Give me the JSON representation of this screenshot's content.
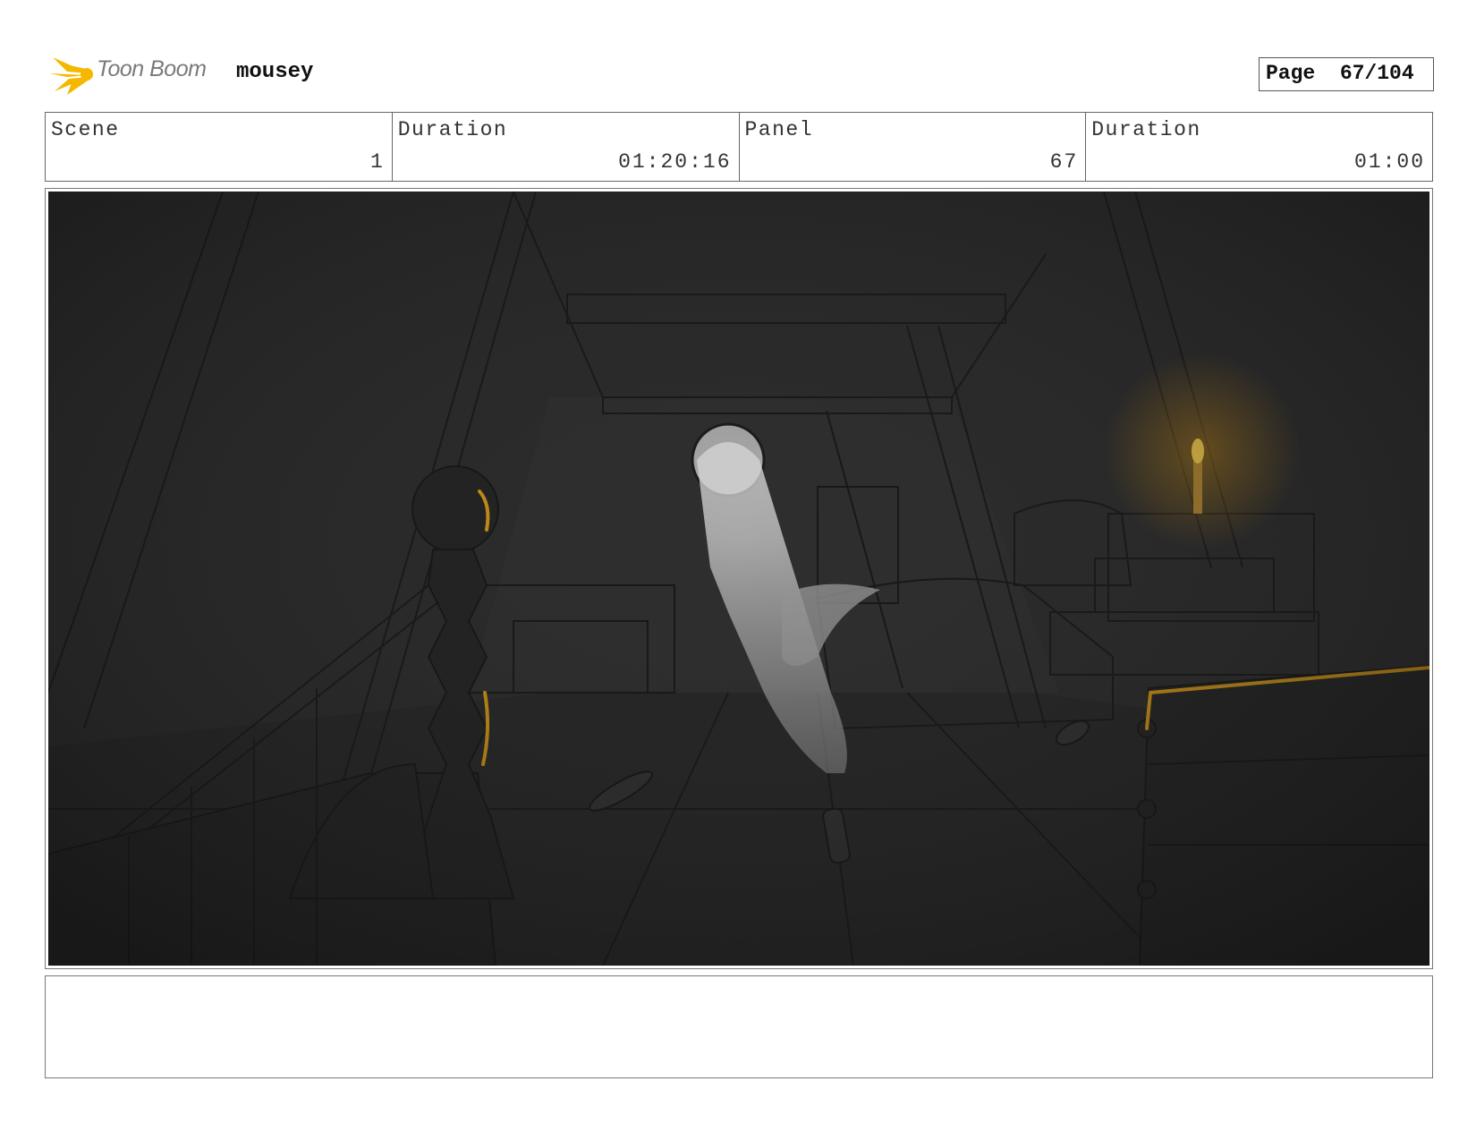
{
  "header": {
    "brand": "Toon Boom",
    "project": "mousey",
    "page_label": "Page",
    "page_number": "67/104"
  },
  "info": {
    "scene_label": "Scene",
    "scene_value": "1",
    "scene_duration_label": "Duration",
    "scene_duration_value": "01:20:16",
    "panel_label": "Panel",
    "panel_value": "67",
    "panel_duration_label": "Duration",
    "panel_duration_value": "01:00"
  },
  "colors": {
    "logo": "#f5b800",
    "panel_bg": "#2a2a2a",
    "candle_glow": "#e0a020",
    "ghost_light": "#d8d8d8"
  },
  "notes": {
    "text": ""
  }
}
